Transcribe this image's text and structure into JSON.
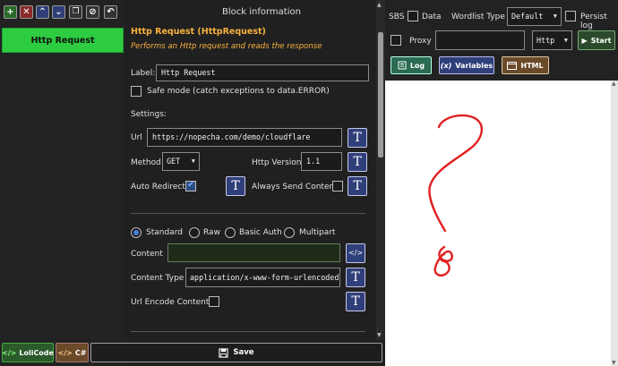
{
  "toolbar": {
    "add": "+",
    "remove": "✕",
    "up": "⌃",
    "down": "⌄",
    "clone": "❐",
    "disable": "⊘",
    "back": "↶"
  },
  "blocks": [
    {
      "label": "Http Request"
    }
  ],
  "bottom": {
    "lolicode": "LoliCode",
    "csharp": "C#",
    "save": "Save"
  },
  "block_info": {
    "title": "Block information",
    "name": "Http Request (HttpRequest)",
    "description": "Performs an Http request and reads the response",
    "label_caption": "Label:",
    "label_value": "Http Request",
    "safe_mode": "Safe mode (catch exceptions to data.ERROR)",
    "settings": "Settings:",
    "url_label": "Url",
    "url_value": "https://nopecha.com/demo/cloudflare",
    "method_label": "Method",
    "method_value": "GET",
    "http_version_label": "Http Version",
    "http_version_value": "1.1",
    "auto_redirect": "Auto Redirect",
    "always_send_content": "Always Send Content",
    "modes": [
      "Standard",
      "Raw",
      "Basic Auth",
      "Multipart"
    ],
    "content_label": "Content",
    "content_value": "",
    "content_type_label": "Content Type",
    "content_type_value": "application/x-www-form-urlencoded",
    "url_encode_label": "Url Encode Content",
    "t_glyph": "T",
    "code_glyph": "</>"
  },
  "debugger": {
    "sbs": "SBS",
    "data": "Data",
    "wordlist_type_label": "Wordlist Type",
    "wordlist_type_value": "Default",
    "persist_log": "Persist log",
    "proxy": "Proxy",
    "proxy_value": "",
    "proxy_type": "Http",
    "start": "Start",
    "log": "Log",
    "variables": "Variables",
    "html": "HTML"
  },
  "colors": {
    "accent_green": "#2ecc40",
    "block_title_orange": "#f7b13d",
    "t_button_blue": "#2f3f7a",
    "annotation_red": "#e02020"
  }
}
